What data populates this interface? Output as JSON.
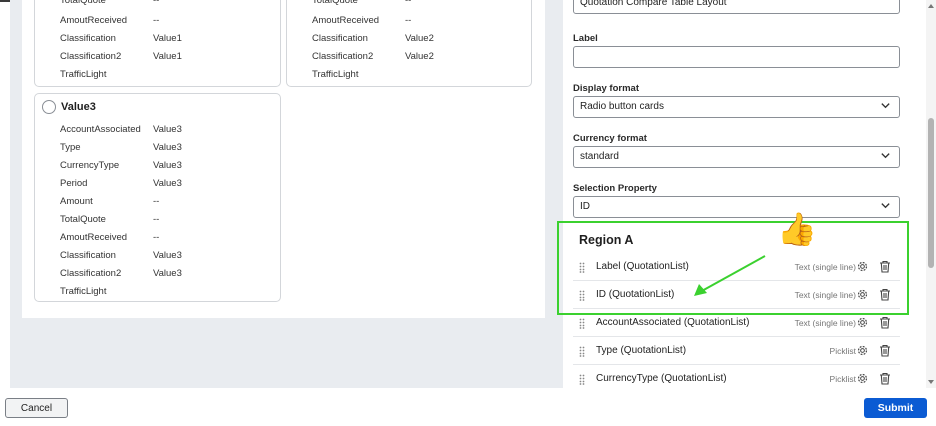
{
  "cards": {
    "card_top_left": {
      "rows": [
        {
          "key": "TotalQuote",
          "value": "--"
        },
        {
          "key": "AmoutReceived",
          "value": "--"
        },
        {
          "key": "Classification",
          "value": "Value1"
        },
        {
          "key": "Classification2",
          "value": "Value1"
        },
        {
          "key": "TrafficLight",
          "value": ""
        }
      ]
    },
    "card_top_right": {
      "rows": [
        {
          "key": "TotalQuote",
          "value": "--"
        },
        {
          "key": "AmoutReceived",
          "value": "--"
        },
        {
          "key": "Classification",
          "value": "Value2"
        },
        {
          "key": "Classification2",
          "value": "Value2"
        },
        {
          "key": "TrafficLight",
          "value": ""
        }
      ]
    },
    "card_value3": {
      "title": "Value3",
      "rows": [
        {
          "key": "AccountAssociated",
          "value": "Value3"
        },
        {
          "key": "Type",
          "value": "Value3"
        },
        {
          "key": "CurrencyType",
          "value": "Value3"
        },
        {
          "key": "Period",
          "value": "Value3"
        },
        {
          "key": "Amount",
          "value": "--"
        },
        {
          "key": "TotalQuote",
          "value": "--"
        },
        {
          "key": "AmoutReceived",
          "value": "--"
        },
        {
          "key": "Classification",
          "value": "Value3"
        },
        {
          "key": "Classification2",
          "value": "Value3"
        },
        {
          "key": "TrafficLight",
          "value": ""
        }
      ]
    }
  },
  "properties": {
    "layout_value": "Quotation Compare Table Layout",
    "label_label": "Label",
    "label_value": "",
    "display_format_label": "Display format",
    "display_format_value": "Radio button cards",
    "currency_format_label": "Currency format",
    "currency_format_value": "standard",
    "selection_property_label": "Selection Property",
    "selection_property_value": "ID",
    "region_title": "Region A",
    "fields": [
      {
        "name": "Label (QuotationList)",
        "type": "Text (single line)"
      },
      {
        "name": "ID (QuotationList)",
        "type": "Text (single line)"
      },
      {
        "name": "AccountAssociated (QuotationList)",
        "type": "Text (single line)"
      },
      {
        "name": "Type (QuotationList)",
        "type": "Picklist"
      },
      {
        "name": "CurrencyType (QuotationList)",
        "type": "Picklist"
      }
    ]
  },
  "footer": {
    "cancel_label": "Cancel",
    "submit_label": "Submit"
  },
  "annotations": {
    "highlight_color": "#3bd12f",
    "thumb": "👍"
  },
  "colors": {
    "primary": "#0b5bd3",
    "panel_bg": "#e9ecf0"
  }
}
